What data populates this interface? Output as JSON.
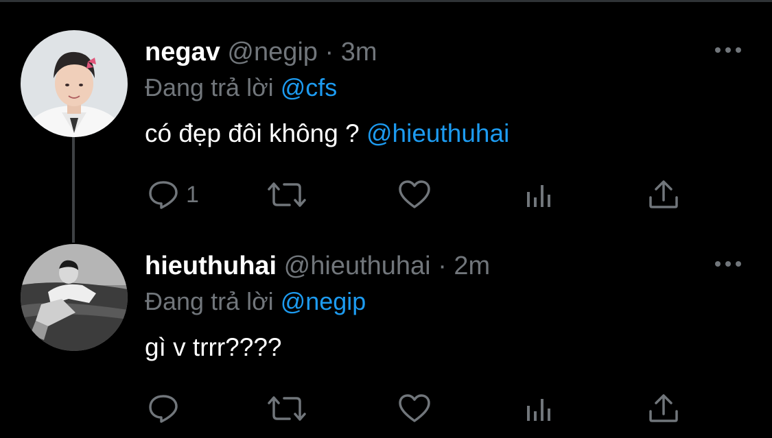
{
  "colors": {
    "background": "#000000",
    "text": "#ffffff",
    "muted": "#71767b",
    "link": "#1d9bf0",
    "thread_line": "#3e4144"
  },
  "tweets": [
    {
      "name": "negav",
      "handle": "@negip",
      "sep": "·",
      "time": "3m",
      "reply_prefix": "Đang trả lời ",
      "reply_to": "@cfs",
      "text": "có đẹp đôi không ? ",
      "text_mention": "@hieuthuhai",
      "reply_count": "1",
      "icons": [
        "avatar-photo",
        "more-icon",
        "reply-icon",
        "retweet-icon",
        "like-icon",
        "analytics-icon",
        "share-icon"
      ]
    },
    {
      "name": "hieuthuhai",
      "handle": "@hieuthuhai",
      "sep": "·",
      "time": "2m",
      "reply_prefix": "Đang trả lời ",
      "reply_to": "@negip",
      "text": "gì v trrr????",
      "text_mention": "",
      "reply_count": "",
      "icons": [
        "avatar-photo",
        "more-icon",
        "reply-icon",
        "retweet-icon",
        "like-icon",
        "analytics-icon",
        "share-icon"
      ]
    }
  ]
}
